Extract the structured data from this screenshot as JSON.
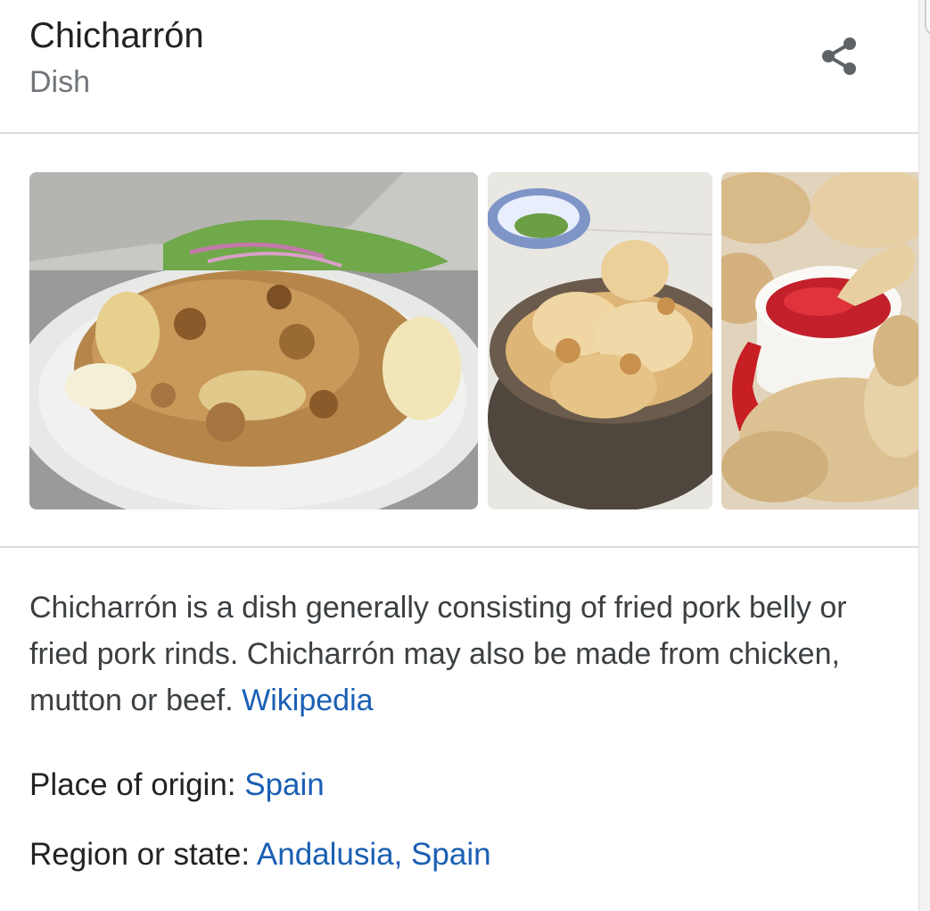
{
  "header": {
    "title": "Chicharrón",
    "subtitle": "Dish"
  },
  "images": [
    {
      "icon": "fried-pork-plate-photo"
    },
    {
      "icon": "pork-rinds-bowl-photo"
    },
    {
      "icon": "pork-rinds-dip-photo"
    }
  ],
  "description": {
    "text": "Chicharrón is a dish generally consisting of fried pork belly or fried pork rinds. Chicharrón may also be made from chicken, mutton or beef.",
    "source_link": "Wikipedia"
  },
  "facts": [
    {
      "label": "Place of origin:",
      "value": "Spain"
    },
    {
      "label": "Region or state:",
      "value": "Andalusia, Spain"
    }
  ],
  "colors": {
    "link": "#1a5fb4",
    "title": "#222222",
    "subtitle": "#70757a",
    "divider": "#dadce0"
  }
}
